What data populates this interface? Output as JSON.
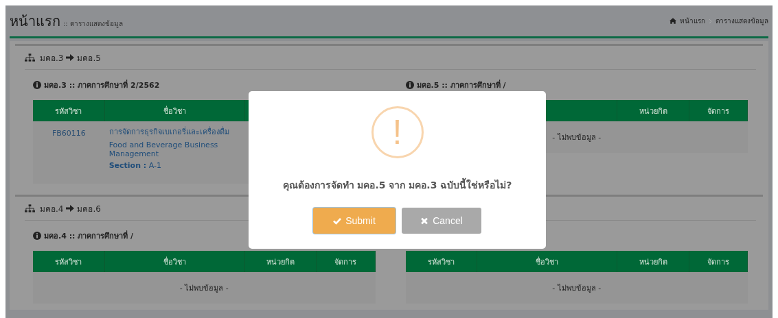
{
  "page_title": "หน้าแรก",
  "page_subtitle": ":: ตารางแสดงข้อมูล",
  "breadcrumb": [
    {
      "label": "หน้าแรก"
    },
    {
      "label": "ตารางแสดงข้อมูล"
    }
  ],
  "sections": [
    {
      "from": "มคอ.3",
      "to": "มคอ.5",
      "panels": [
        {
          "title": "มคอ.3 :: ภาคการศึกษาที่ 2/2562",
          "columns": [
            "รหัสวิชา",
            "ชื่อวิชา"
          ],
          "rows": [
            {
              "code": "FB60116",
              "name_th": "การจัดการธุรกิจเบเกอรี่และเครื่องดื่ม",
              "name_en": "Food and Beverage Business Management",
              "section": "**Section :** A-1"
            }
          ]
        },
        {
          "title": "มคอ.5 :: ภาคการศึกษาที่ /",
          "columns": [
            "หน่วยกิต",
            "จัดการ"
          ],
          "empty_text": "- ไม่พบข้อมูล -"
        }
      ]
    },
    {
      "from": "มคอ.4",
      "to": "มคอ.6",
      "panels": [
        {
          "title": "มคอ.4 :: ภาคการศึกษาที่ /",
          "columns": [
            "รหัสวิชา",
            "ชื่อวิชา",
            "หน่วยกิต",
            "จัดการ"
          ],
          "empty_text": "- ไม่พบข้อมูล -"
        },
        {
          "columns": [
            "รหัสวิชา",
            "ชื่อวิชา",
            "หน่วยกิต",
            "จัดการ"
          ],
          "empty_text": "- ไม่พบข้อมูล -"
        }
      ]
    }
  ],
  "modal": {
    "icon": "!",
    "message": "คุณต้องการจัดทำ มคอ.5 จาก มคอ.3 ฉบับนี้ใช่หรือไม่?",
    "buttons": [
      {
        "label": "Submit",
        "kind": "confirm"
      },
      {
        "label": "Cancel",
        "kind": "cancel"
      }
    ]
  }
}
